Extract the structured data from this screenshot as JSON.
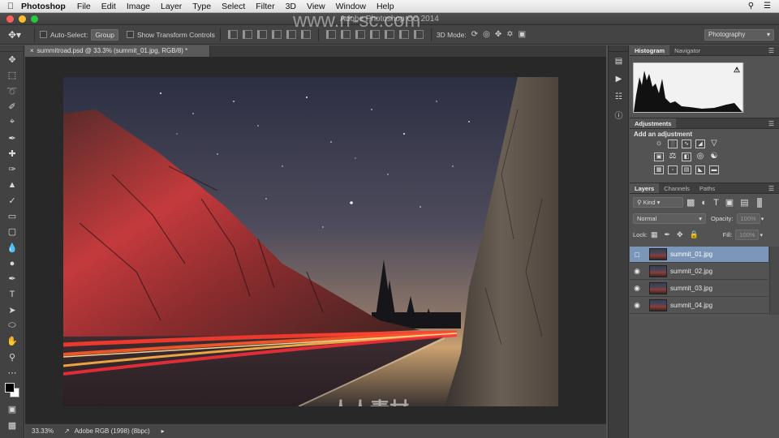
{
  "menubar": {
    "app_name": "Photoshop",
    "items": [
      "File",
      "Edit",
      "Image",
      "Layer",
      "Type",
      "Select",
      "Filter",
      "3D",
      "View",
      "Window",
      "Help"
    ]
  },
  "window": {
    "title": "Adobe Photoshop CC 2014"
  },
  "options_bar": {
    "auto_select_label": "Auto-Select:",
    "auto_select_value": "Group",
    "transform_label": "Show Transform Controls",
    "mode_3d_label": "3D Mode:",
    "workspace": "Photography"
  },
  "document": {
    "tab_title": "summitroad.psd @ 33.3% (summit_01.jpg, RGB/8) *",
    "zoom": "33.33%",
    "profile": "Adobe RGB (1998) (8bpc)"
  },
  "panels": {
    "histogram_tab": "Histogram",
    "navigator_tab": "Navigator",
    "adjustments_tab": "Adjustments",
    "adjustments_hint": "Add an adjustment",
    "layers_tab": "Layers",
    "channels_tab": "Channels",
    "paths_tab": "Paths",
    "filter_kind": "Kind",
    "blend_mode": "Normal",
    "opacity_label": "Opacity:",
    "opacity_value": "100%",
    "lock_label": "Lock:",
    "fill_label": "Fill:",
    "fill_value": "100%"
  },
  "layers": [
    {
      "name": "summit_01.jpg",
      "visible": false,
      "selected": true
    },
    {
      "name": "summit_02.jpg",
      "visible": true,
      "selected": false
    },
    {
      "name": "summit_03.jpg",
      "visible": true,
      "selected": false
    },
    {
      "name": "summit_04.jpg",
      "visible": true,
      "selected": false
    }
  ],
  "watermark": {
    "url": "www.rr-sc.com",
    "brand": "人人素材"
  },
  "colors": {
    "selection": "#7b96b8",
    "panel_bg": "#535353",
    "canvas_bg": "#282828"
  }
}
